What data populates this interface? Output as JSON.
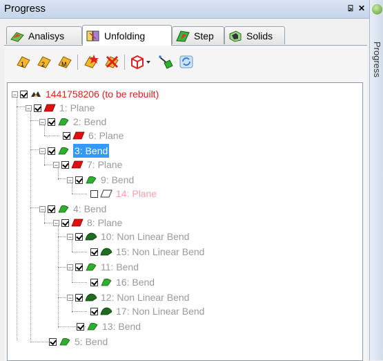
{
  "window": {
    "title": "Progress"
  },
  "tabs": [
    {
      "label": "Analisys",
      "icon": "analysis-icon"
    },
    {
      "label": "Unfolding",
      "icon": "unfolding-icon"
    },
    {
      "label": "Step",
      "icon": "step-icon"
    },
    {
      "label": "Solids",
      "icon": "solids-icon"
    }
  ],
  "side_panel": {
    "text": "Progress"
  },
  "toolbar": {
    "items": [
      "bend-tool-1-icon",
      "bend-tool-2-icon",
      "bend-tool-m-icon",
      "bend-star-icon",
      "bend-cross-icon",
      "red-cube-dropdown-icon",
      "wand-icon",
      "refresh-icon"
    ]
  },
  "tree": {
    "nodes": [
      {
        "label": "1441758206 (to be rebuilt)",
        "color": "red"
      },
      {
        "label": "1: Plane"
      },
      {
        "label": "2: Bend"
      },
      {
        "label": "6: Plane"
      },
      {
        "label": "3: Bend",
        "selected": true
      },
      {
        "label": "7: Plane"
      },
      {
        "label": "9: Bend"
      },
      {
        "label": "14: Plane",
        "color": "pink"
      },
      {
        "label": "4: Bend"
      },
      {
        "label": "8: Plane"
      },
      {
        "label": "10: Non Linear Bend"
      },
      {
        "label": "15: Non Linear Bend"
      },
      {
        "label": "11: Bend"
      },
      {
        "label": "16: Bend"
      },
      {
        "label": "12: Non Linear Bend"
      },
      {
        "label": "17: Non Linear Bend"
      },
      {
        "label": "13: Bend"
      },
      {
        "label": "5: Bend"
      }
    ]
  },
  "colors": {
    "plane": "#e01010",
    "bend": "#2db02d",
    "nonlinear_bend": "#1f6b1f",
    "selection": "#3399ff"
  }
}
